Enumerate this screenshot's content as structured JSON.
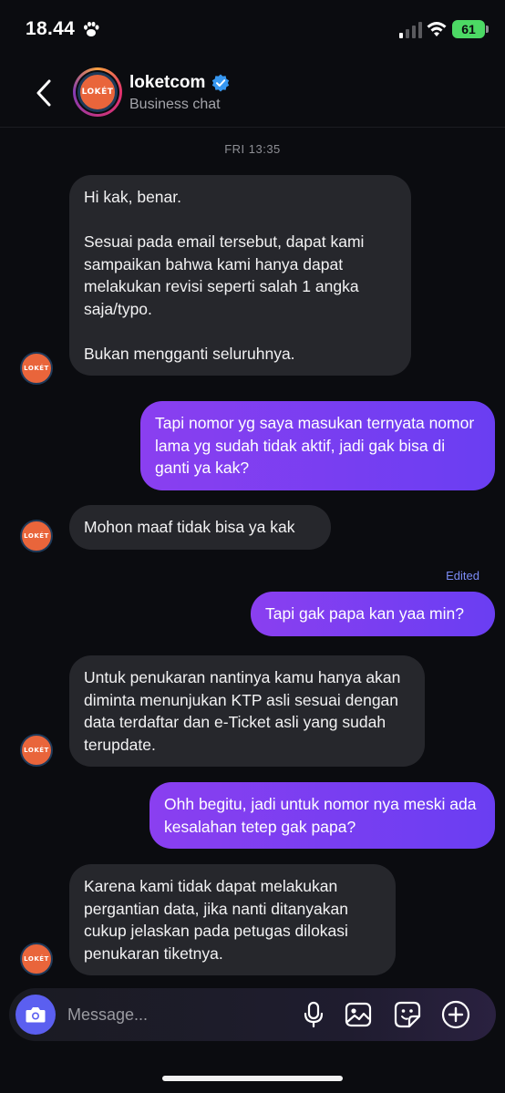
{
  "status_bar": {
    "time": "18.44",
    "battery": "61"
  },
  "header": {
    "contact_name": "loketcom",
    "subtitle": "Business chat",
    "avatar_text": "LOKÉT"
  },
  "chat": {
    "date_label": "FRI 13:35",
    "edited_label": "Edited",
    "messages": [
      {
        "direction": "received",
        "text": "Hi kak, benar.\n\nSesuai pada email tersebut, dapat kami sampaikan bahwa kami hanya dapat melakukan revisi seperti salah 1 angka saja/typo.\n\nBukan mengganti seluruhnya."
      },
      {
        "direction": "sent",
        "text": "Tapi nomor yg saya masukan ternyata nomor lama yg sudah tidak aktif, jadi gak bisa di ganti ya kak?"
      },
      {
        "direction": "received",
        "text": "Mohon maaf tidak bisa ya kak"
      },
      {
        "direction": "sent",
        "text": "Tapi gak papa kan yaa min?"
      },
      {
        "direction": "received",
        "text": "Untuk penukaran nantinya kamu hanya akan diminta menunjukan KTP asli sesuai dengan data terdaftar dan e-Ticket asli yang sudah terupdate."
      },
      {
        "direction": "sent",
        "text": "Ohh begitu, jadi untuk nomor nya meski ada kesalahan tetep gak papa?"
      },
      {
        "direction": "received",
        "text": "Karena kami tidak dapat melakukan pergantian data, jika nanti ditanyakan cukup jelaskan pada petugas dilokasi penukaran tiketnya."
      }
    ]
  },
  "composer": {
    "placeholder": "Message..."
  },
  "colors": {
    "background": "#0b0c10",
    "received_bubble": "#26272c",
    "sent_gradient_start": "#8a3ff0",
    "sent_gradient_end": "#6a3ef2",
    "accent": "#5b5ff0",
    "logo_orange": "#e9653b"
  },
  "icons": [
    "paw-icon",
    "signal-icon",
    "wifi-icon",
    "back-chevron-icon",
    "verified-badge-icon",
    "camera-icon",
    "microphone-icon",
    "image-icon",
    "sticker-icon",
    "plus-icon"
  ]
}
